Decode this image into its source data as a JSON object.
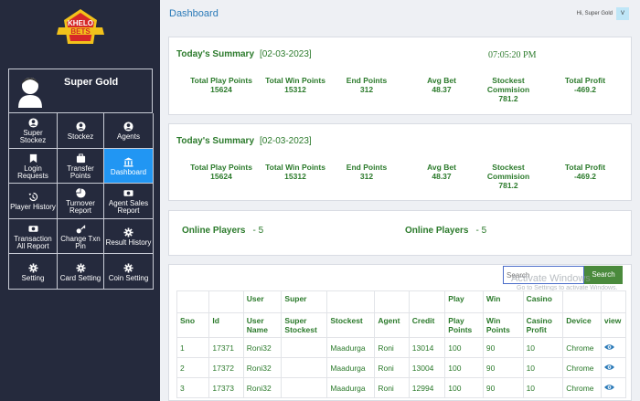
{
  "sidebar": {
    "logo_text": [
      "KHELO",
      "BETS"
    ],
    "user_name": "Super Gold",
    "menu": [
      {
        "label": "Super Stockez",
        "icon": "user-circle-icon",
        "active": false
      },
      {
        "label": "Stockez",
        "icon": "user-circle-icon",
        "active": false
      },
      {
        "label": "Agents",
        "icon": "user-circle-icon",
        "active": false
      },
      {
        "label": "Login Requests",
        "icon": "bookmark-icon",
        "active": false
      },
      {
        "label": "Transfer Points",
        "icon": "briefcase-icon",
        "active": false
      },
      {
        "label": "Dashboard",
        "icon": "bank-icon",
        "active": true
      },
      {
        "label": "Player History",
        "icon": "history-icon",
        "active": false
      },
      {
        "label": "Turnover Report",
        "icon": "pie-chart-icon",
        "active": false
      },
      {
        "label": "Agent Sales Report",
        "icon": "cash-icon",
        "active": false
      },
      {
        "label": "Transaction All Report",
        "icon": "cash-icon",
        "active": false
      },
      {
        "label": "Change Txn Pin",
        "icon": "key-icon",
        "active": false
      },
      {
        "label": "Result History",
        "icon": "gear-icon",
        "active": false
      },
      {
        "label": "Setting",
        "icon": "gear-icon",
        "active": false
      },
      {
        "label": "Card Setting",
        "icon": "gear-icon",
        "active": false
      },
      {
        "label": "Coin Setting",
        "icon": "gear-icon",
        "active": false
      }
    ]
  },
  "header": {
    "title": "Dashboard",
    "greeting": "Hi, Super Gold",
    "avatar_initial": "V"
  },
  "summary1": {
    "title": "Today's Summary",
    "date": "[02-03-2023]",
    "time": "07:05:20 PM",
    "stats": [
      {
        "label": "Total Play Points",
        "value": "15624"
      },
      {
        "label": "Total Win Points",
        "value": "15312"
      },
      {
        "label": "End Points",
        "value": "312"
      },
      {
        "label": "Avg Bet",
        "value": "48.37"
      },
      {
        "label": "Stockest Commision",
        "value": "781.2"
      },
      {
        "label": "Total Profit",
        "value": "-469.2"
      }
    ]
  },
  "summary2": {
    "title": "Today's Summary",
    "date": "[02-03-2023]",
    "stats": [
      {
        "label": "Total Play Points",
        "value": "15624"
      },
      {
        "label": "Total Win Points",
        "value": "15312"
      },
      {
        "label": "End Points",
        "value": "312"
      },
      {
        "label": "Avg Bet",
        "value": "48.37"
      },
      {
        "label": "Stockest Commision",
        "value": "781.2"
      },
      {
        "label": "Total Profit",
        "value": "-469.2"
      }
    ]
  },
  "online": {
    "left_label": "Online Players",
    "left_value": "- 5",
    "right_label": "Online Players",
    "right_value": "- 5"
  },
  "search": {
    "placeholder": "Search",
    "button": "Search",
    "watermark_title": "Activate Windows",
    "watermark_sub": "Go to Settings to activate Windows."
  },
  "table": {
    "header_top": [
      "",
      "",
      "User",
      "Super",
      "",
      "",
      "",
      "Play",
      "Win",
      "Casino",
      "",
      ""
    ],
    "header_bottom": [
      "Sno",
      "Id",
      "User Name",
      "Super Stockest",
      "Stockest",
      "Agent",
      "Credit",
      "Play Points",
      "Win Points",
      "Casino Profit",
      "Device",
      "view"
    ],
    "rows": [
      [
        "1",
        "17371",
        "Roni32",
        "",
        "Maadurga",
        "Roni",
        "13014",
        "100",
        "90",
        "10",
        "Chrome"
      ],
      [
        "2",
        "17372",
        "Roni32",
        "",
        "Maadurga",
        "Roni",
        "13004",
        "100",
        "90",
        "10",
        "Chrome"
      ],
      [
        "3",
        "17373",
        "Roni32",
        "",
        "Maadurga",
        "Roni",
        "12994",
        "100",
        "90",
        "10",
        "Chrome"
      ]
    ]
  }
}
